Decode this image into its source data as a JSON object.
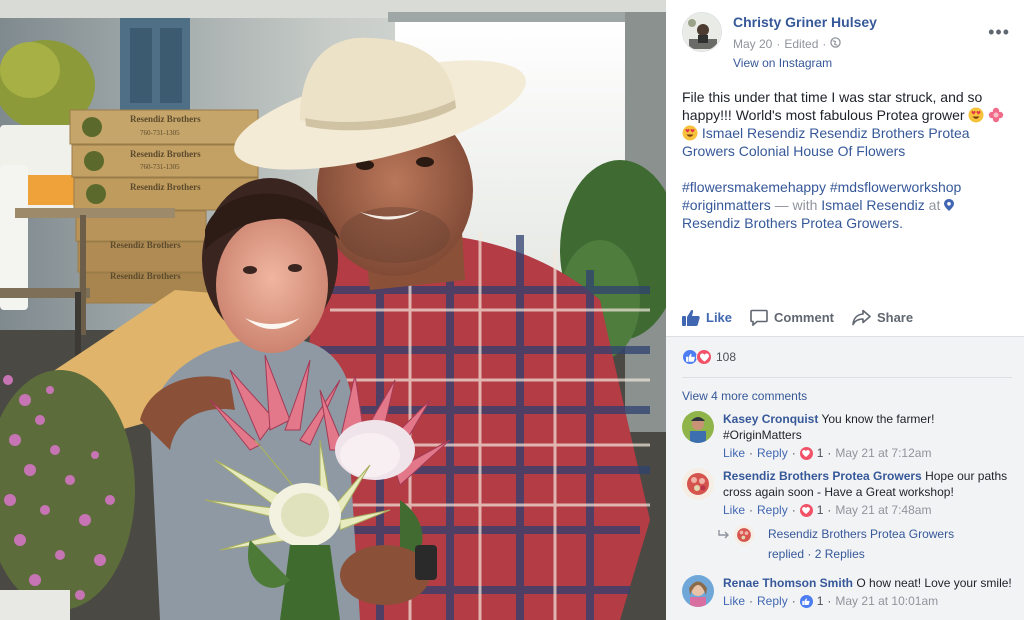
{
  "photo": {
    "box_brand": "Resendiz Brothers",
    "box_phone": "760-731-1305"
  },
  "post": {
    "author": "Christy Griner Hulsey",
    "date": "May 20",
    "edited": "Edited",
    "view_on": "View on Instagram",
    "text_line1": "File this under that time I was star struck, and so happy!!! World's most fabulous Protea grower",
    "tag_names": "Ismael Resendiz Resendiz Brothers Protea Growers Colonial House Of Flowers",
    "hashtags": "#flowersmakemehappy #mdsflowerworkshop #originmatters",
    "with_text": "— with",
    "with_person": "Ismael Resendiz",
    "at_text": "at",
    "place": "Resendiz Brothers Protea Growers."
  },
  "actions": {
    "like": "Like",
    "comment": "Comment",
    "share": "Share"
  },
  "reactions": {
    "count": "108"
  },
  "comments": {
    "view_more": "View 4 more comments",
    "items": [
      {
        "name": "Kasey Cronquist",
        "text": "You know the farmer! #OriginMatters",
        "like": "Like",
        "reply": "Reply",
        "reacts": "1",
        "date": "May 21 at 7:12am"
      },
      {
        "name": "Resendiz Brothers Protea Growers",
        "text": "Hope our paths cross again soon - Have a Great workshop!",
        "like": "Like",
        "reply": "Reply",
        "reacts": "1",
        "date": "May 21 at 7:48am"
      },
      {
        "name": "Renae Thomson Smith",
        "text": "O how neat! Love your smile!",
        "like": "Like",
        "reply": "Reply",
        "reacts": "1",
        "date": "May 21 at 10:01am"
      }
    ],
    "reply_thread": {
      "name": "Resendiz Brothers Protea Growers",
      "replied": "replied",
      "count": "2 Replies"
    }
  },
  "colors": {
    "link": "#365899",
    "like_blue": "#4267b2",
    "love_red": "#f25268",
    "comments_bg": "#f2f3f5"
  }
}
